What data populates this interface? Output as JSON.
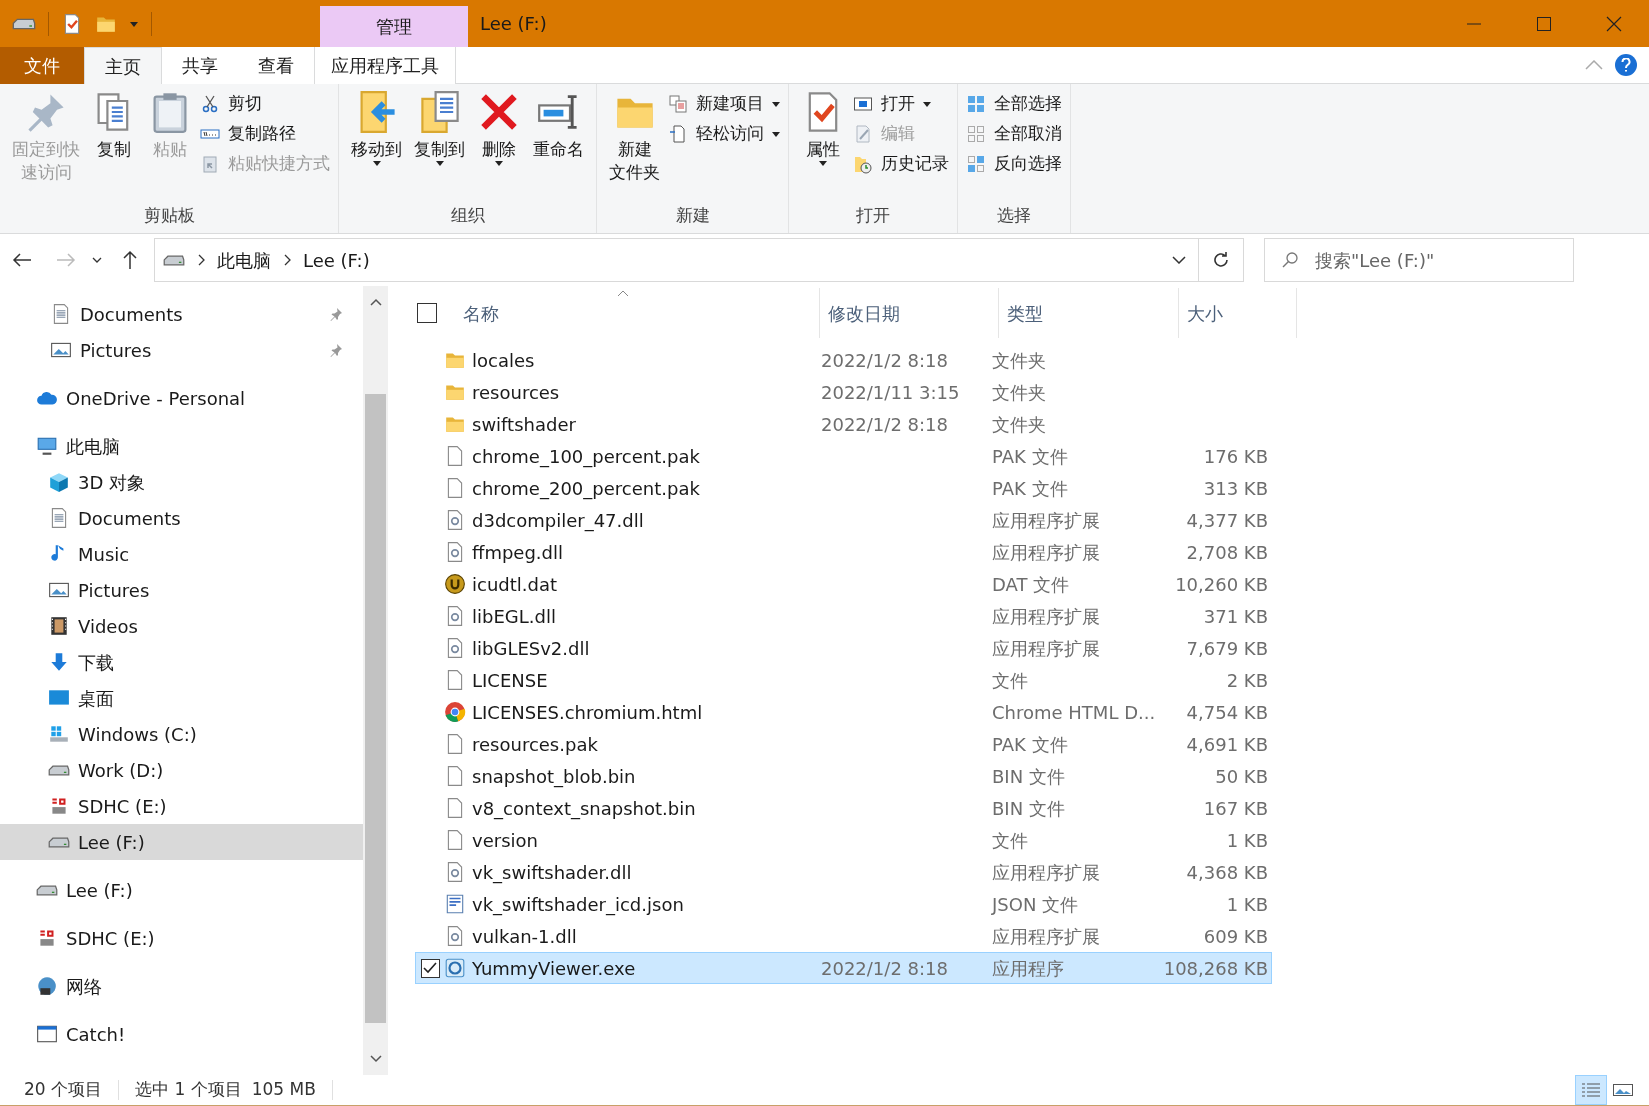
{
  "window": {
    "title": "Lee (F:)",
    "context_tab": "管理"
  },
  "ribbon_tabs": [
    {
      "label": "文件",
      "kind": "file",
      "selected": false
    },
    {
      "label": "主页",
      "kind": "tab",
      "selected": true
    },
    {
      "label": "共享",
      "kind": "tab",
      "selected": false
    },
    {
      "label": "查看",
      "kind": "tab",
      "selected": false
    },
    {
      "label": "应用程序工具",
      "kind": "context",
      "selected": false
    }
  ],
  "ribbon_groups": [
    {
      "label": "剪贴板",
      "items": [
        {
          "kind": "large",
          "lines": [
            "固定到快",
            "速访问"
          ],
          "disabled": true,
          "dropdown": false
        },
        {
          "kind": "large",
          "lines": [
            "复制"
          ],
          "disabled": false,
          "dropdown": false
        },
        {
          "kind": "large",
          "lines": [
            "粘贴"
          ],
          "disabled": true,
          "dropdown": false
        },
        {
          "kind": "stack",
          "children": [
            {
              "label": "剪切",
              "disabled": false,
              "dropdown": false
            },
            {
              "label": "复制路径",
              "disabled": false,
              "dropdown": false
            },
            {
              "label": "粘贴快捷方式",
              "disabled": true,
              "dropdown": false
            }
          ]
        }
      ]
    },
    {
      "label": "组织",
      "items": [
        {
          "kind": "large",
          "lines": [
            "移动到"
          ],
          "disabled": false,
          "dropdown": true
        },
        {
          "kind": "large",
          "lines": [
            "复制到"
          ],
          "disabled": false,
          "dropdown": true
        },
        {
          "kind": "large",
          "lines": [
            "删除"
          ],
          "disabled": false,
          "dropdown": true
        },
        {
          "kind": "large",
          "lines": [
            "重命名"
          ],
          "disabled": false,
          "dropdown": false
        }
      ]
    },
    {
      "label": "新建",
      "items": [
        {
          "kind": "large",
          "lines": [
            "新建",
            "文件夹"
          ],
          "disabled": false,
          "dropdown": false
        },
        {
          "kind": "stack",
          "children": [
            {
              "label": "新建项目",
              "disabled": false,
              "dropdown": true
            },
            {
              "label": "轻松访问",
              "disabled": false,
              "dropdown": true
            }
          ]
        }
      ]
    },
    {
      "label": "打开",
      "items": [
        {
          "kind": "large",
          "lines": [
            "属性"
          ],
          "disabled": false,
          "dropdown": true
        },
        {
          "kind": "stack",
          "children": [
            {
              "label": "打开",
              "disabled": false,
              "dropdown": true
            },
            {
              "label": "编辑",
              "disabled": true,
              "dropdown": false
            },
            {
              "label": "历史记录",
              "disabled": false,
              "dropdown": false
            }
          ]
        }
      ]
    },
    {
      "label": "选择",
      "items": [
        {
          "kind": "stack",
          "children": [
            {
              "label": "全部选择",
              "disabled": false,
              "dropdown": false
            },
            {
              "label": "全部取消",
              "disabled": false,
              "dropdown": false
            },
            {
              "label": "反向选择",
              "disabled": false,
              "dropdown": false
            }
          ]
        }
      ]
    }
  ],
  "address_bar": {
    "crumbs": [
      "此电脑",
      "Lee (F:)"
    ]
  },
  "search": {
    "placeholder": "搜索\"Lee (F:)\""
  },
  "quick_access_items": [
    {
      "label": "Documents",
      "kind": "docs",
      "pinned": true
    },
    {
      "label": "Pictures",
      "kind": "pics",
      "pinned": true
    }
  ],
  "nav_tree": [
    {
      "label": "OneDrive - Personal",
      "kind": "cloud",
      "selected": false
    },
    {
      "label": "此电脑",
      "kind": "pc",
      "selected": false,
      "children": [
        {
          "label": "3D 对象",
          "kind": "cube",
          "selected": false
        },
        {
          "label": "Documents",
          "kind": "docs",
          "selected": false
        },
        {
          "label": "Music",
          "kind": "music",
          "selected": false
        },
        {
          "label": "Pictures",
          "kind": "pics",
          "selected": false
        },
        {
          "label": "Videos",
          "kind": "video",
          "selected": false
        },
        {
          "label": "下载",
          "kind": "download",
          "selected": false
        },
        {
          "label": "桌面",
          "kind": "desktop",
          "selected": false
        },
        {
          "label": "Windows (C:)",
          "kind": "windrive",
          "selected": false
        },
        {
          "label": "Work (D:)",
          "kind": "drive",
          "selected": false
        },
        {
          "label": "SDHC (E:)",
          "kind": "sd",
          "selected": false
        },
        {
          "label": "Lee (F:)",
          "kind": "drive",
          "selected": true
        }
      ]
    },
    {
      "label": "Lee (F:)",
      "kind": "drive",
      "selected": false
    },
    {
      "label": "SDHC (E:)",
      "kind": "sd",
      "selected": false
    },
    {
      "label": "网络",
      "kind": "network",
      "selected": false
    },
    {
      "label": "Catch!",
      "kind": "window",
      "selected": false
    }
  ],
  "table": {
    "select_all": {
      "checked": false
    },
    "columns": [
      "名称",
      "修改日期",
      "类型",
      "大小"
    ],
    "rows": [
      {
        "name": "locales",
        "kind": "folder",
        "date": "2022/1/2 8:18",
        "type": "文件夹",
        "selected": false
      },
      {
        "name": "resources",
        "kind": "folder",
        "date": "2022/1/11 3:15",
        "type": "文件夹",
        "selected": false
      },
      {
        "name": "swiftshader",
        "kind": "folder",
        "date": "2022/1/2 8:18",
        "type": "文件夹",
        "selected": false
      },
      {
        "name": "chrome_100_percent.pak",
        "kind": "file",
        "type": "PAK 文件",
        "size": "176 KB",
        "selected": false
      },
      {
        "name": "chrome_200_percent.pak",
        "kind": "file",
        "type": "PAK 文件",
        "size": "313 KB",
        "selected": false
      },
      {
        "name": "d3dcompiler_47.dll",
        "kind": "dll",
        "type": "应用程序扩展",
        "size": "4,377 KB",
        "selected": false
      },
      {
        "name": "ffmpeg.dll",
        "kind": "dll",
        "type": "应用程序扩展",
        "size": "2,708 KB",
        "selected": false
      },
      {
        "name": "icudtl.dat",
        "kind": "dat",
        "type": "DAT 文件",
        "size": "10,260 KB",
        "selected": false
      },
      {
        "name": "libEGL.dll",
        "kind": "dll",
        "type": "应用程序扩展",
        "size": "371 KB",
        "selected": false
      },
      {
        "name": "libGLESv2.dll",
        "kind": "dll",
        "type": "应用程序扩展",
        "size": "7,679 KB",
        "selected": false
      },
      {
        "name": "LICENSE",
        "kind": "file",
        "type": "文件",
        "size": "2 KB",
        "selected": false
      },
      {
        "name": "LICENSES.chromium.html",
        "kind": "browser",
        "type": "Chrome HTML D...",
        "size": "4,754 KB",
        "selected": false
      },
      {
        "name": "resources.pak",
        "kind": "file",
        "type": "PAK 文件",
        "size": "4,691 KB",
        "selected": false
      },
      {
        "name": "snapshot_blob.bin",
        "kind": "file",
        "type": "BIN 文件",
        "size": "50 KB",
        "selected": false
      },
      {
        "name": "v8_context_snapshot.bin",
        "kind": "file",
        "type": "BIN 文件",
        "size": "167 KB",
        "selected": false
      },
      {
        "name": "version",
        "kind": "file",
        "type": "文件",
        "size": "1 KB",
        "selected": false
      },
      {
        "name": "vk_swiftshader.dll",
        "kind": "dll",
        "type": "应用程序扩展",
        "size": "4,368 KB",
        "selected": false
      },
      {
        "name": "vk_swiftshader_icd.json",
        "kind": "json",
        "type": "JSON 文件",
        "size": "1 KB",
        "selected": false
      },
      {
        "name": "vulkan-1.dll",
        "kind": "dll",
        "type": "应用程序扩展",
        "size": "609 KB",
        "selected": false
      },
      {
        "name": "YummyViewer.exe",
        "kind": "exe",
        "date": "2022/1/2 8:18",
        "type": "应用程序",
        "size": "108,268 KB",
        "selected": true
      }
    ]
  },
  "status_bar": {
    "count": "20 个项目",
    "selection": "选中 1 个项目",
    "selection_size": "105 MB"
  },
  "view_buttons": [
    {
      "kind": "details",
      "selected": true
    },
    {
      "kind": "large_icons",
      "selected": false
    }
  ]
}
